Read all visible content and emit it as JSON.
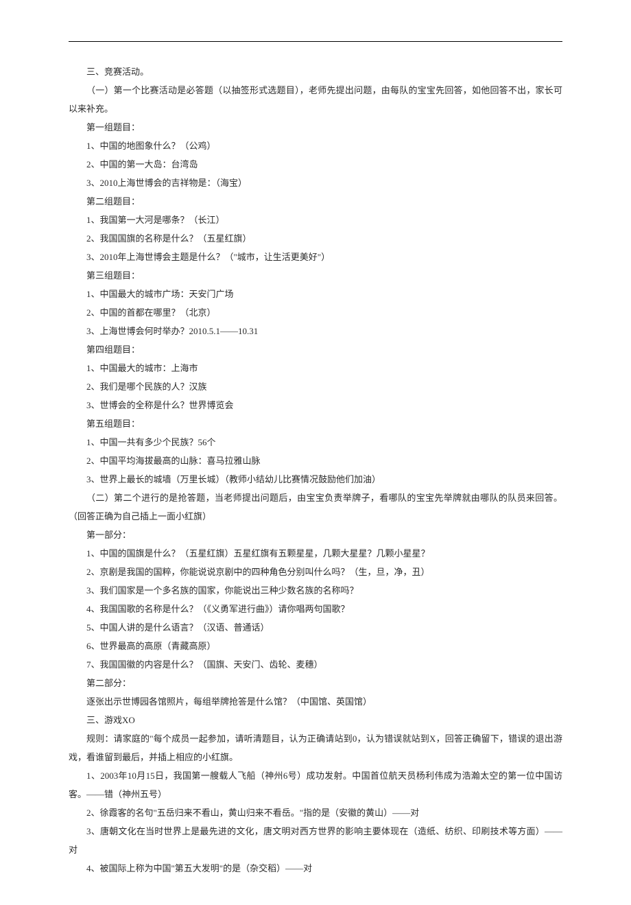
{
  "lines": [
    {
      "text": "三、竞赛活动。",
      "indent": 1
    },
    {
      "text": "（一）第一个比赛活动是必答题（以抽签形式选题目），老师先提出问题，由每队的宝宝先回答，如他回答不出，家长可以来补充。",
      "indent": 1,
      "wrap": true
    },
    {
      "text": "第一组题目：",
      "indent": 1
    },
    {
      "text": "1、中国的地图象什么？（公鸡）",
      "indent": 1
    },
    {
      "text": "2、中国的第一大岛：台湾岛",
      "indent": 1
    },
    {
      "text": "3、2010上海世博会的吉祥物是：（海宝）",
      "indent": 1
    },
    {
      "text": "第二组题目：",
      "indent": 1
    },
    {
      "text": "1、我国第一大河是哪条？（长江）",
      "indent": 1
    },
    {
      "text": "2、我国国旗的名称是什么？（五星红旗）",
      "indent": 1
    },
    {
      "text": "3、2010年上海世博会主题是什么？（\"城市，让生活更美好\"）",
      "indent": 1
    },
    {
      "text": "第三组题目：",
      "indent": 1
    },
    {
      "text": "1、中国最大的城市广场：天安门广场",
      "indent": 1
    },
    {
      "text": "2、中国的首都在哪里？（北京）",
      "indent": 1
    },
    {
      "text": "3、上海世博会何时举办？2010.5.1——10.31",
      "indent": 1
    },
    {
      "text": "第四组题目：",
      "indent": 1
    },
    {
      "text": "1、中国最大的城市：上海市",
      "indent": 1
    },
    {
      "text": "2、我们是哪个民族的人？汉族",
      "indent": 1
    },
    {
      "text": "3、世博会的全称是什么？世界博览会",
      "indent": 1
    },
    {
      "text": "第五组题目：",
      "indent": 1
    },
    {
      "text": "1、中国一共有多少个民族？56个",
      "indent": 1
    },
    {
      "text": "2、中国平均海拔最高的山脉：喜马拉雅山脉",
      "indent": 1
    },
    {
      "text": "3、世界上最长的城墙（万里长城）（教师小结幼儿比赛情况鼓励他们加油）",
      "indent": 1
    },
    {
      "text": "（二）第二个进行的是抢答题，当老师提出问题后，由宝宝负责举牌子，看哪队的宝宝先举牌就由哪队的队员来回答。（回答正确为自己插上一面小红旗）",
      "indent": 1,
      "wrap": true
    },
    {
      "text": "第一部分：",
      "indent": 1
    },
    {
      "text": "1、中国的国旗是什么？（五星红旗）五星红旗有五颗星星，几颗大星星？几颗小星星？",
      "indent": 1
    },
    {
      "text": "2、京剧是我国的国粹，你能说说京剧中的四种角色分别叫什么吗？（生，旦，净，丑）",
      "indent": 1
    },
    {
      "text": "3、我们国家是一个多名族的国家，你能说出三种少数名族的名称吗？",
      "indent": 1
    },
    {
      "text": "4、我国国歌的名称是什么？（《义勇军进行曲》）请你唱两句国歌？",
      "indent": 1
    },
    {
      "text": "5、中国人讲的是什么语言？（汉语、普通话）",
      "indent": 1
    },
    {
      "text": "6、世界最高的高原（青藏高原）",
      "indent": 1
    },
    {
      "text": "7、我国国徽的内容是什么？（国旗、天安门、齿轮、麦穗）",
      "indent": 1
    },
    {
      "text": "第二部分：",
      "indent": 1
    },
    {
      "text": "逐张出示世博园各馆照片，每组举牌抢答是什么馆？（中国馆、英国馆）",
      "indent": 1
    },
    {
      "text": "三、游戏XO",
      "indent": 1
    },
    {
      "text": "规则：请家庭的\"每个成员一起参加，请听清题目，认为正确请站到0，认为错误就站到X，回答正确留下，错误的退出游戏，看谁留到最后，并插上相应的小红旗。",
      "indent": 1,
      "wrap": true
    },
    {
      "text": "1、2003年10月15日，我国第一艘载人飞船（神州6号）成功发射。中国首位航天员杨利伟成为浩瀚太空的第一位中国访客。——错（神州五号）",
      "indent": 1,
      "wrap": true
    },
    {
      "text": "2、徐霞客的名句\"五岳归来不看山，黄山归来不看岳。\"指的是（安徽的黄山）——对",
      "indent": 1
    },
    {
      "text": "3、唐朝文化在当时世界上是最先进的文化，唐文明对西方世界的影响主要体现在（造纸、纺织、印刷技术等方面）——对",
      "indent": 1,
      "wrap": true
    },
    {
      "text": "4、被国际上称为中国\"第五大发明\"的是（杂交稻）——对",
      "indent": 1
    }
  ]
}
